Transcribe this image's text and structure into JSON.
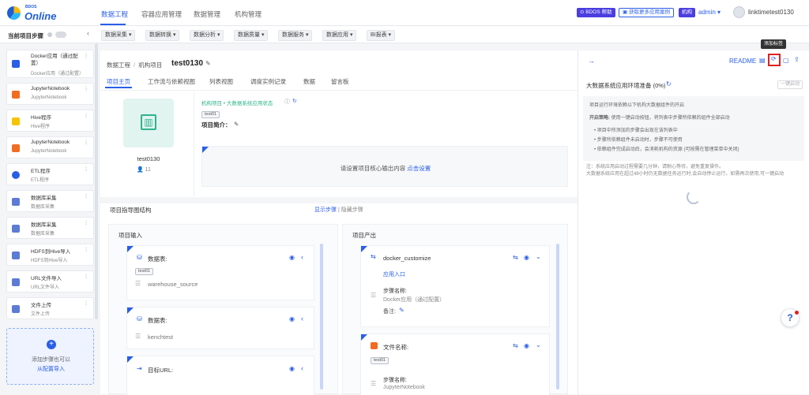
{
  "app": {
    "logo_small": "BDOS",
    "logo_big": "Online"
  },
  "topnav": {
    "tabs": [
      "数据工程",
      "容器应用管理",
      "数据管理",
      "机构管理"
    ],
    "help_label": "BDOS 帮助",
    "more_label": "获取更多应用案例",
    "org_badge": "机构",
    "admin_label": "admin ▾",
    "user_label": "linktimetest0130"
  },
  "subbar": {
    "current_step_label": "当前项目步骤",
    "modules": [
      "数据采集 ▾",
      "数据转换 ▾",
      "数据分析 ▾",
      "数据质量 ▾",
      "数据服务 ▾",
      "数据应用 ▾",
      "BI报表 ▾"
    ]
  },
  "sidebar": {
    "items": [
      {
        "name": "Docker应用（通过配置）",
        "sub": "Docker应用（通过配置）",
        "color": "#2a5ee8"
      },
      {
        "name": "JupyterNotebook",
        "sub": "JupyterNotebook",
        "color": "#f26c22"
      },
      {
        "name": "Hive程序",
        "sub": "Hive程序",
        "color": "#f5c400"
      },
      {
        "name": "JupyterNotebook",
        "sub": "JupyterNotebook",
        "color": "#f26c22"
      },
      {
        "name": "ETL程序",
        "sub": "ETL程序",
        "color": "#2a5ee8"
      },
      {
        "name": "数据库采集",
        "sub": "数据库采集",
        "color": "#5b7bd5"
      },
      {
        "name": "数据库采集",
        "sub": "数据库采集",
        "color": "#5b7bd5"
      },
      {
        "name": "HDFS到Hive导入",
        "sub": "HDFS到Hive导入",
        "color": "#5b7bd5"
      },
      {
        "name": "URL文件导入",
        "sub": "URL文件导入",
        "color": "#5b7bd5"
      },
      {
        "name": "文件上传",
        "sub": "文件上传",
        "color": "#5b7bd5"
      }
    ],
    "add_line1": "添加步骤也可以",
    "add_line2": "从配置导入"
  },
  "main": {
    "breadcrumb1": "数据工程",
    "sep": "/",
    "breadcrumb2": "机构项目",
    "project": "test0130",
    "tabs": [
      "项目主页",
      "工作流与依赖视图",
      "列表视图",
      "调度实例记录",
      "数据",
      "留言板"
    ],
    "proj_name": "test0130",
    "members": "11",
    "status_line": "机构项目 • 大数据系统应用状态",
    "proj_tag": "test01",
    "intro_label": "项目简介：",
    "core_hint": "请设置项目核心输出内容",
    "core_link": "点击设置",
    "structure_title": "项目指导图结构",
    "show_steps": "显示步骤",
    "hide_steps": "隐藏步骤",
    "input_title": "项目输入",
    "output_title": "项目产出",
    "inputs": [
      {
        "label": "数据表:",
        "tag": "test01",
        "value": "warehouse_source"
      },
      {
        "label": "数据表:",
        "value": "kenchtest"
      },
      {
        "label": "目标URL:"
      }
    ],
    "outputs": [
      {
        "name": "docker_customize",
        "link": "应用入口",
        "step_label": "步骤名称:",
        "step_value": "Docker应用（通过配置）",
        "note": "备注:"
      },
      {
        "name": "文件名称:",
        "tag": "test01",
        "step_label": "步骤名称:",
        "step_value": "JupyterNotebook"
      }
    ]
  },
  "rpanel": {
    "readme": "README",
    "tooltip": "添加标签",
    "title": "大数据系统应用环境准备 (0%)",
    "onekey": "一键启动",
    "info1": "项目运行环境依赖以下机构大数据组件的开启",
    "info2_label": "开启策略:",
    "info2": "使用一键启动按钮，将列表中步骤所依赖的组件全部启动",
    "bullets": [
      "项目中所添加的步骤会出现在该列表中",
      "步骤所依赖组件未启动时，步骤不可使用",
      "依赖组件完成启动后，会消耗机构的资源 (可按需在管理菜单中关闭)"
    ],
    "note1": "注：系统应用启动过程需要几分钟，请耐心等待，避免重复操作。",
    "note2": "大数据系统应用在超过48小时仍无数据任务运行时,会自动停止运行，如需再次使用,可一键启动",
    "help_icon": "?"
  }
}
